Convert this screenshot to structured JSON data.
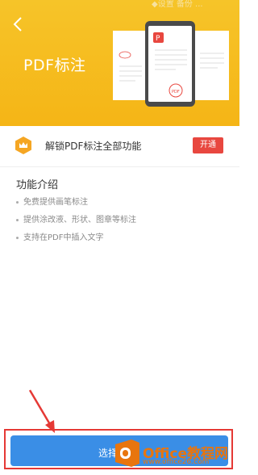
{
  "status_bar": {
    "partial_text": "◆设置 备份 ..."
  },
  "header": {
    "title": "PDF标注"
  },
  "unlock": {
    "label": "解锁PDF标注全部功能",
    "button": "开通"
  },
  "intro": {
    "title": "功能介绍",
    "items": [
      "免费提供画笔标注",
      "提供涂改液、形状、图章等标注",
      "支持在PDF中插入文字"
    ]
  },
  "bottom": {
    "select_label": "选择文档"
  },
  "watermark": {
    "name": "Office教程网",
    "url": "www.office26.com"
  },
  "colors": {
    "banner": "#f6c429",
    "accent_red": "#e8473f",
    "primary_blue": "#3a8ee6",
    "highlight_frame": "#e53935"
  }
}
